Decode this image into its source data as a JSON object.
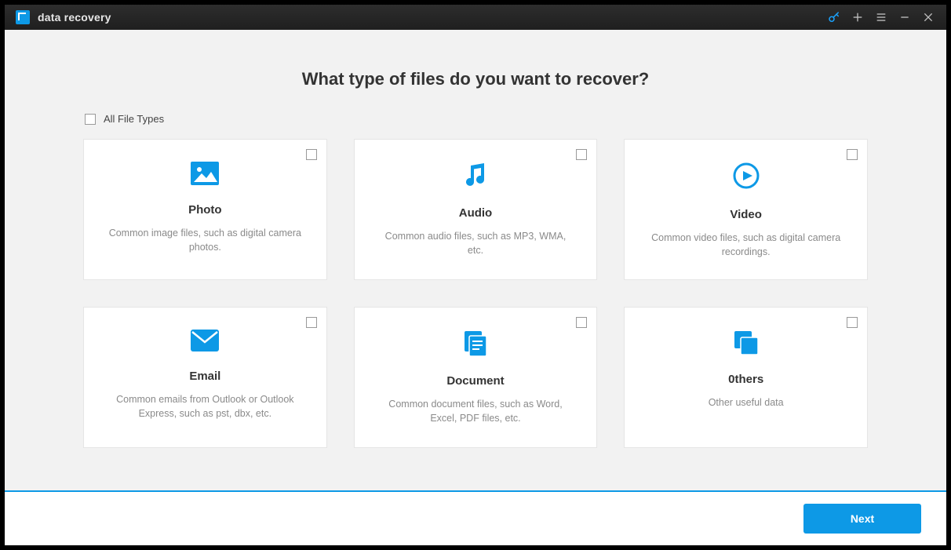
{
  "app": {
    "title": "data recovery"
  },
  "main": {
    "heading": "What type of files do you want to recover?",
    "all_label": "All File Types",
    "cards": [
      {
        "title": "Photo",
        "desc": "Common image files, such as digital camera photos."
      },
      {
        "title": "Audio",
        "desc": "Common audio files, such as MP3, WMA, etc."
      },
      {
        "title": "Video",
        "desc": "Common video files, such as digital camera recordings."
      },
      {
        "title": "Email",
        "desc": "Common emails from Outlook or Outlook Express, such as pst, dbx, etc."
      },
      {
        "title": "Document",
        "desc": "Common document files, such as Word, Excel, PDF files, etc."
      },
      {
        "title": "0thers",
        "desc": "Other useful data"
      }
    ]
  },
  "footer": {
    "next_label": "Next"
  },
  "icons": {
    "key": "key-icon",
    "plus": "plus-icon",
    "menu": "menu-icon",
    "minimize": "minimize-icon",
    "close": "close-icon"
  },
  "colors": {
    "accent": "#0d99e6"
  }
}
